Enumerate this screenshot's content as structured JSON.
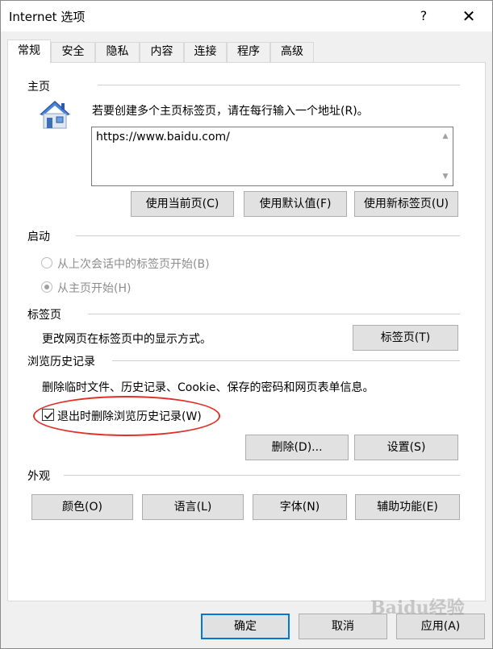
{
  "window": {
    "title": "Internet 选项",
    "help_label": "?",
    "close_label": "✕"
  },
  "tabs": [
    {
      "label": "常规",
      "active": true
    },
    {
      "label": "安全"
    },
    {
      "label": "隐私"
    },
    {
      "label": "内容"
    },
    {
      "label": "连接"
    },
    {
      "label": "程序"
    },
    {
      "label": "高级"
    }
  ],
  "homepage": {
    "section_title": "主页",
    "instruction": "若要创建多个主页标签页，请在每行输入一个地址(R)。",
    "url_value": "https://www.baidu.com/",
    "buttons": {
      "use_current": "使用当前页(C)",
      "use_default": "使用默认值(F)",
      "use_new_tab": "使用新标签页(U)"
    }
  },
  "startup": {
    "section_title": "启动",
    "option_last_session": "从上次会话中的标签页开始(B)",
    "option_homepage": "从主页开始(H)",
    "selected": "option_homepage"
  },
  "tabs_section": {
    "section_title": "标签页",
    "description": "更改网页在标签页中的显示方式。",
    "button": "标签页(T)"
  },
  "history": {
    "section_title": "浏览历史记录",
    "description": "删除临时文件、历史记录、Cookie、保存的密码和网页表单信息。",
    "checkbox_label": "退出时删除浏览历史记录(W)",
    "checkbox_checked": true,
    "delete_button": "删除(D)...",
    "settings_button": "设置(S)"
  },
  "appearance": {
    "section_title": "外观",
    "colors": "颜色(O)",
    "languages": "语言(L)",
    "fonts": "字体(N)",
    "accessibility": "辅助功能(E)"
  },
  "footer": {
    "ok": "确定",
    "cancel": "取消",
    "apply": "应用(A)"
  },
  "watermark": "Baidu经验",
  "colors": {
    "accent_blue": "#0078d7",
    "highlight_red": "#e0302a"
  }
}
